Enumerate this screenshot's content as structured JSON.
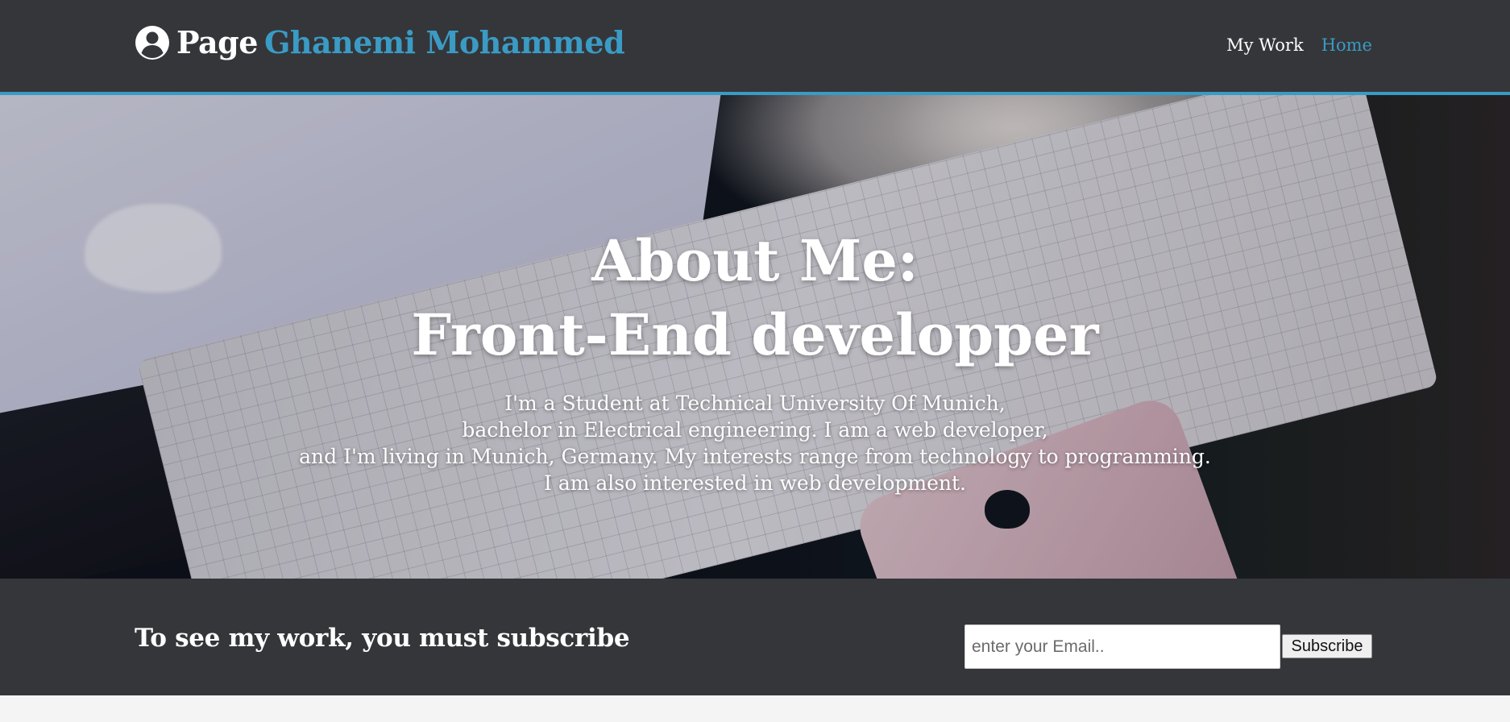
{
  "header": {
    "brand_first": "Page",
    "brand_name": "Ghanemi Mohammed",
    "brand_icon": "user-circle-icon",
    "nav": {
      "my_work": "My Work",
      "home": "Home"
    }
  },
  "hero": {
    "title_line1": "About Me:",
    "title_line2": "Front-End developper",
    "text_lines": [
      "I'm a Student at Technical University Of Munich,",
      "bachelor in Electrical engineering. I am a web developer,",
      "and I'm living in Munich, Germany. My interests range from technology to programming.",
      "I am also interested in web development."
    ]
  },
  "subscribe": {
    "title": "To see my work, you must subscribe",
    "email_placeholder": "enter your Email..",
    "email_value": "",
    "button_label": "Subscribe"
  },
  "colors": {
    "header_bg": "#35363a",
    "accent": "#3a9bc4",
    "page_bg": "#f4f4f4"
  }
}
